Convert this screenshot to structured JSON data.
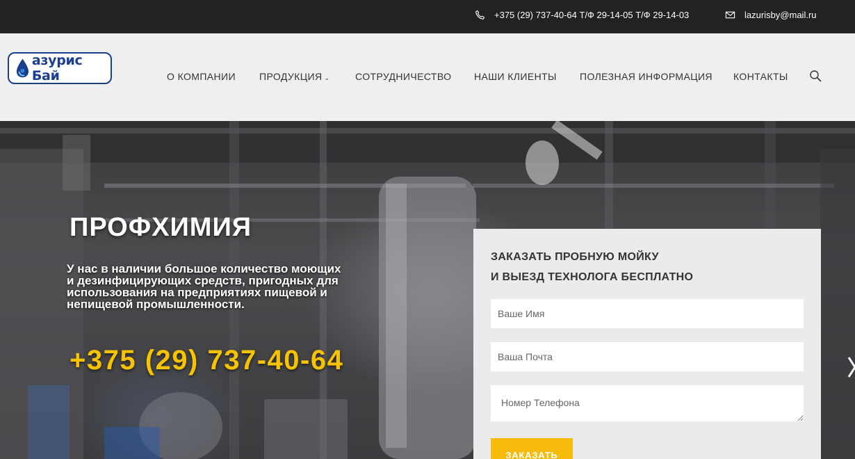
{
  "topbar": {
    "phone_icon": "phone-icon",
    "phone": "+375 (29) 737-40-64 Т/Ф 29-14-05 Т/Ф 29-14-03",
    "mail_icon": "envelope-icon",
    "email": "lazurisby@mail.ru"
  },
  "header": {
    "logo_text": "азурис Бай",
    "logo_icon": "water-drop-icon",
    "nav": [
      {
        "label": "О КОМПАНИИ"
      },
      {
        "label": "ПРОДУКЦИЯ",
        "caret": "⌄"
      },
      {
        "label": "СОТРУДНИЧЕСТВО"
      },
      {
        "label": "НАШИ КЛИЕНТЫ"
      },
      {
        "label": "ПОЛЕЗНАЯ ИНФОРМАЦИЯ"
      },
      {
        "label": "КОНТАКТЫ"
      }
    ],
    "search_icon": "search-icon"
  },
  "hero": {
    "title": "ПРОФХИМИЯ",
    "description": "У нас в наличии большое количество моющих и дезинфицирующих средств, пригодных для использования на предприятиях пищевой и непищевой промышленности.",
    "phone": "+375 (29) 737-40-64",
    "next_icon": "chevron-right-icon"
  },
  "form": {
    "title_line1": "ЗАКАЗАТЬ ПРОБНУЮ МОЙКУ",
    "title_line2": "И ВЫЕЗД ТЕХНОЛОГА БЕСПЛАТНО",
    "name_placeholder": "Ваше Имя",
    "email_placeholder": "Ваша Почта",
    "phone_placeholder": "Номер Телефона",
    "submit_label": "ЗАКАЗАТЬ"
  },
  "colors": {
    "topbar_bg": "#222222",
    "header_bg": "#efefef",
    "accent_yellow": "#f7c300",
    "button_yellow": "#f7bb0e",
    "logo_blue": "#1a3f8f"
  }
}
